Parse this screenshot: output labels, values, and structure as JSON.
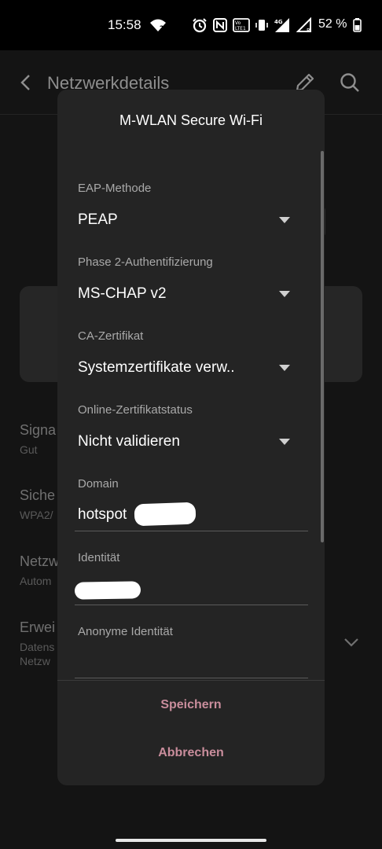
{
  "status_bar": {
    "time": "15:58",
    "battery_percent": "52 %",
    "volte_label": "Vo LTE 1",
    "network_label": "4G",
    "icons": [
      "wifi-question-icon",
      "alarm-icon",
      "nfc-icon",
      "volte-icon",
      "vibrate-icon",
      "signal-4g-icon",
      "signal-r-icon",
      "battery-icon"
    ]
  },
  "page": {
    "title": "Netzwerkdetails",
    "rows": [
      {
        "title": "Signa",
        "subtitle": "Gut"
      },
      {
        "title": "Siche",
        "subtitle": "WPA2/"
      },
      {
        "title": "Netzw",
        "subtitle": "Autom"
      },
      {
        "title": "Erwei",
        "subtitle": "Datens",
        "subtitle2": "Netzw"
      }
    ]
  },
  "dialog": {
    "title": "M-WLAN Secure Wi-Fi",
    "fields": {
      "eap_method": {
        "label": "EAP-Methode",
        "value": "PEAP"
      },
      "phase2": {
        "label": "Phase 2-Authentifizierung",
        "value": "MS-CHAP v2"
      },
      "ca_cert": {
        "label": "CA-Zertifikat",
        "value": "Systemzertifikate verw.."
      },
      "online_status": {
        "label": "Online-Zertifikatstatus",
        "value": "Nicht validieren"
      },
      "domain": {
        "label": "Domain",
        "value": "hotspot"
      },
      "identity": {
        "label": "Identität",
        "value": ""
      },
      "anon_identity": {
        "label": "Anonyme Identität",
        "value": ""
      }
    },
    "buttons": {
      "save": "Speichern",
      "cancel": "Abbrechen"
    }
  },
  "colors": {
    "accent": "#c98d9c",
    "dialog_bg": "#242424",
    "page_bg": "#141414"
  }
}
